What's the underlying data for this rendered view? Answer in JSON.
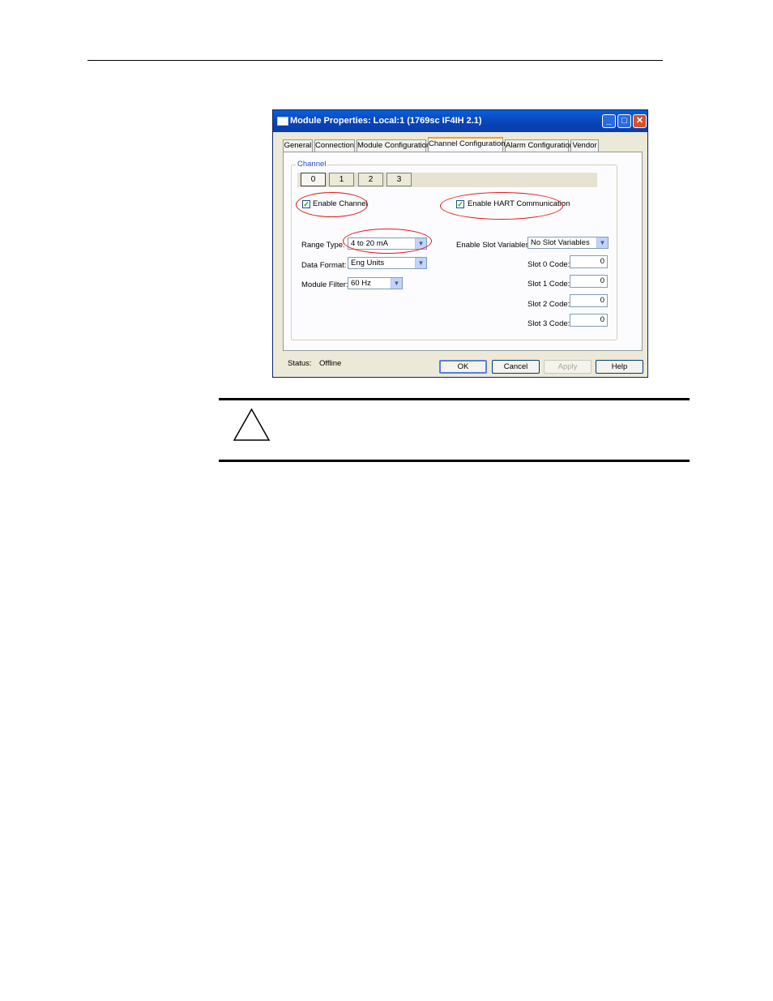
{
  "dialog": {
    "title": "Module Properties: Local:1 (1769sc IF4IH 2.1)",
    "tabs": [
      {
        "label": "General"
      },
      {
        "label": "Connection"
      },
      {
        "label": "Module Configuration"
      },
      {
        "label": "Channel Configuration",
        "active": true
      },
      {
        "label": "Alarm Configuration"
      },
      {
        "label": "Vendor"
      }
    ],
    "channel_group_label": "Channel",
    "channels": [
      "0",
      "1",
      "2",
      "3"
    ],
    "selected_channel": "0",
    "enable_channel": {
      "label": "Enable Channel",
      "checked": true
    },
    "enable_hart": {
      "label": "Enable HART Communication",
      "checked": true
    },
    "range_type": {
      "label": "Range Type:",
      "value": "4 to 20 mA"
    },
    "data_format": {
      "label": "Data Format:",
      "value": "Eng Units"
    },
    "module_filter": {
      "label": "Module Filter:",
      "value": "60 Hz"
    },
    "slot_variables": {
      "label": "Enable Slot Variables:",
      "value": "No Slot Variables"
    },
    "slot_codes": [
      {
        "label": "Slot 0 Code:",
        "value": "0"
      },
      {
        "label": "Slot 1 Code:",
        "value": "0"
      },
      {
        "label": "Slot 2 Code:",
        "value": "0"
      },
      {
        "label": "Slot 3 Code:",
        "value": "0"
      }
    ],
    "status_label": "Status:",
    "status_value": "Offline",
    "buttons": {
      "ok": "OK",
      "cancel": "Cancel",
      "apply": "Apply",
      "help": "Help"
    }
  },
  "colors": {
    "titlebar": "#0842b8",
    "annotation": "#e01818"
  },
  "icons": {
    "warning": "warning-triangle-icon",
    "checkbox": "checkmark-icon",
    "dropdown": "chevron-down-icon"
  }
}
